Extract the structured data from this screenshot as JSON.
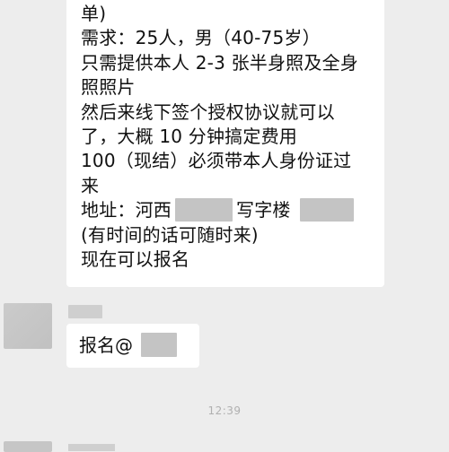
{
  "message_main": {
    "line1": "单)",
    "line2": "需求：25人，男（40-75岁）",
    "line3": "只需提供本人 2-3 张半身照及全身",
    "line4": "照照片",
    "line5": "然后来线下签个授权协议就可以",
    "line6": "了，大概 10 分钟搞定费用",
    "line7": "100（现结）必须带本人身份证过",
    "line8": "来",
    "line9_prefix": "地址：河西",
    "line9_middle": "写字楼",
    "line10": "(有时间的话可随时来)",
    "line11": "现在可以报名"
  },
  "message_reply": {
    "text": "报名@"
  },
  "timestamp": "12:39",
  "colors": {
    "background": "#ededed",
    "bubble": "#ffffff",
    "redaction": "#c4c4c4",
    "text": "#111111",
    "timestamp": "#b0b0b0"
  }
}
